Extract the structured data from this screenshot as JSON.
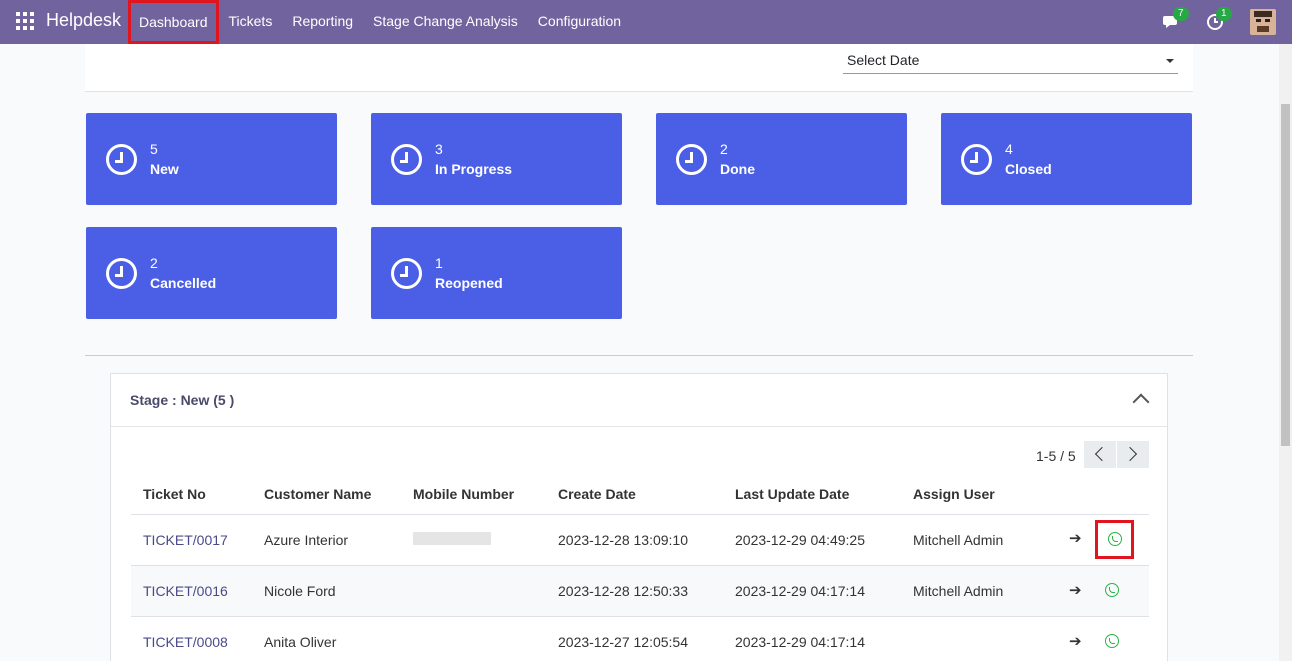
{
  "app": {
    "brand": "Helpdesk"
  },
  "menu": [
    {
      "label": "Dashboard",
      "active": true
    },
    {
      "label": "Tickets"
    },
    {
      "label": "Reporting"
    },
    {
      "label": "Stage Change Analysis"
    },
    {
      "label": "Configuration"
    }
  ],
  "nav": {
    "messages_count": "7",
    "activities_count": "1"
  },
  "filter": {
    "date_placeholder": "Select Date"
  },
  "stage_cards": [
    {
      "count": "5",
      "label": "New"
    },
    {
      "count": "3",
      "label": "In Progress"
    },
    {
      "count": "2",
      "label": "Done"
    },
    {
      "count": "4",
      "label": "Closed"
    },
    {
      "count": "2",
      "label": "Cancelled"
    },
    {
      "count": "1",
      "label": "Reopened"
    }
  ],
  "panel": {
    "title": "Stage : New (5 )",
    "pager": "1-5 / 5",
    "columns": [
      "Ticket No",
      "Customer Name",
      "Mobile Number",
      "Create Date",
      "Last Update Date",
      "Assign User"
    ],
    "rows": [
      {
        "ticket": "TICKET/0017",
        "customer": "Azure Interior",
        "mobile": "",
        "created": "2023-12-28 13:09:10",
        "updated": "2023-12-29 04:49:25",
        "user": "Mitchell Admin"
      },
      {
        "ticket": "TICKET/0016",
        "customer": "Nicole Ford",
        "mobile": "",
        "created": "2023-12-28 12:50:33",
        "updated": "2023-12-29 04:17:14",
        "user": "Mitchell Admin"
      },
      {
        "ticket": "TICKET/0008",
        "customer": "Anita Oliver",
        "mobile": "",
        "created": "2023-12-27 12:05:54",
        "updated": "2023-12-29 04:17:14",
        "user": ""
      }
    ]
  },
  "colors": {
    "navbar": "#71639e",
    "card": "#4b5fe6",
    "highlight": "#e0151f",
    "whatsapp": "#28b446"
  }
}
